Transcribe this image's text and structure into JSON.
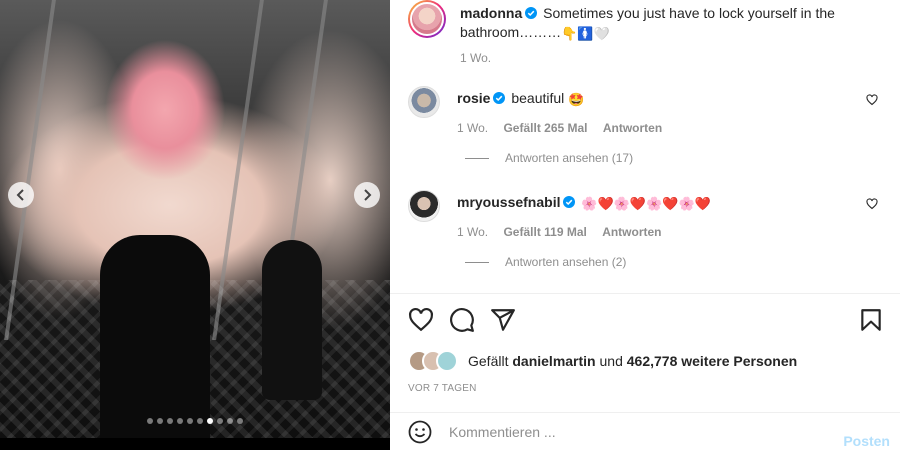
{
  "post": {
    "username": "madonna",
    "caption": "Sometimes you just have to lock yourself in the bathroom………",
    "caption_emojis": "👇🚺🤍",
    "time": "1 Wo."
  },
  "carousel": {
    "slide_count": 10,
    "active_index": 6
  },
  "comments": [
    {
      "username": "rosie",
      "text": "beautiful",
      "emoji": "🤩",
      "time": "1 Wo.",
      "likes": "Gefällt 265 Mal",
      "reply": "Antworten",
      "view_replies": "Antworten ansehen (17)"
    },
    {
      "username": "mryoussefnabil",
      "text": "",
      "emoji_string": "🌸❤️🌸❤️🌸❤️🌸❤️",
      "time": "1 Wo.",
      "likes": "Gefällt 119 Mal",
      "reply": "Antworten",
      "view_replies": "Antworten ansehen (2)"
    }
  ],
  "likes": {
    "prefix": "Gefällt",
    "user": "danielmartin",
    "connector": "und",
    "others": "462,778 weitere Personen"
  },
  "posted_ago": "VOR 7 TAGEN",
  "composer": {
    "placeholder": "Kommentieren ...",
    "post_label": "Posten"
  },
  "colors": {
    "verified": "#0095f6",
    "heart": "#ed4956",
    "post_button_disabled": "#b2dffc"
  },
  "icons": [
    "heart-icon",
    "comment-icon",
    "share-icon",
    "bookmark-icon",
    "smile-icon",
    "chevron-left-icon",
    "chevron-right-icon",
    "verified-badge-icon"
  ]
}
